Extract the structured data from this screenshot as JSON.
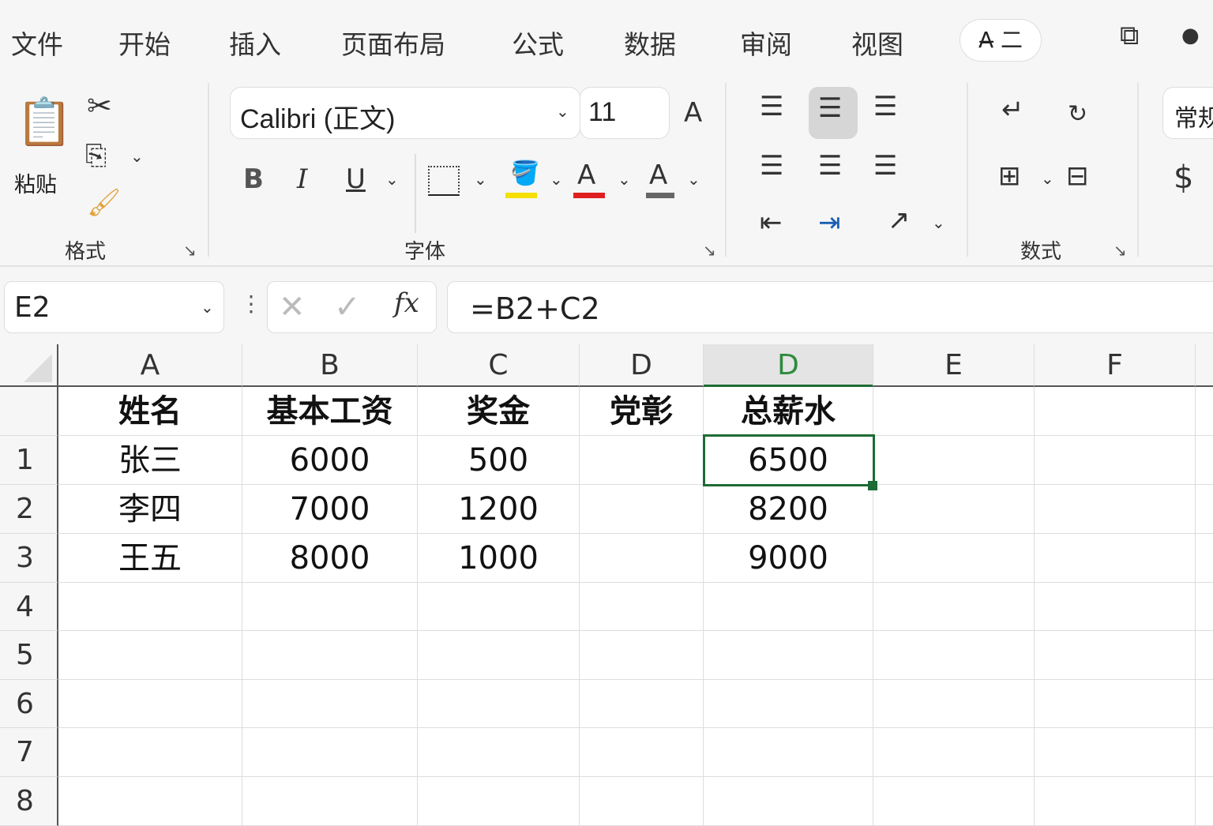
{
  "tabs": [
    "文件",
    "开始",
    "插入",
    "页面布局",
    "公式",
    "数据",
    "审阅",
    "视图"
  ],
  "tab_pill": "A̶ 二",
  "clipboard": {
    "paste_label": "粘贴",
    "group_label": "格式"
  },
  "font": {
    "name": "Calibri (正文)",
    "size": "11",
    "group_label": "字体",
    "bold": "B",
    "italic": "I",
    "underline": "U",
    "font_color_letter": "A",
    "highlight_color": "#f5e000",
    "font_color": "#e02020",
    "gray_color": "#666666"
  },
  "number": {
    "group_label": "数式",
    "format_value": "常规",
    "currency": "$"
  },
  "name_box": "E2",
  "formula": "=B2+C2",
  "fx": "fx",
  "columns": [
    "A",
    "B",
    "C",
    "D",
    "D",
    "E",
    "F"
  ],
  "rows": [
    "1",
    "2",
    "3",
    "4",
    "5",
    "6",
    "7",
    "8"
  ],
  "header_row": [
    "姓名",
    "基本工资",
    "奖金",
    "党彰",
    "总薪水"
  ],
  "data": [
    [
      "张三",
      "6000",
      "500",
      "",
      "6500"
    ],
    [
      "李四",
      "7000",
      "1200",
      "",
      "8200"
    ],
    [
      "王五",
      "8000",
      "1000",
      "",
      "9000"
    ]
  ],
  "accent": "#1e6b35"
}
